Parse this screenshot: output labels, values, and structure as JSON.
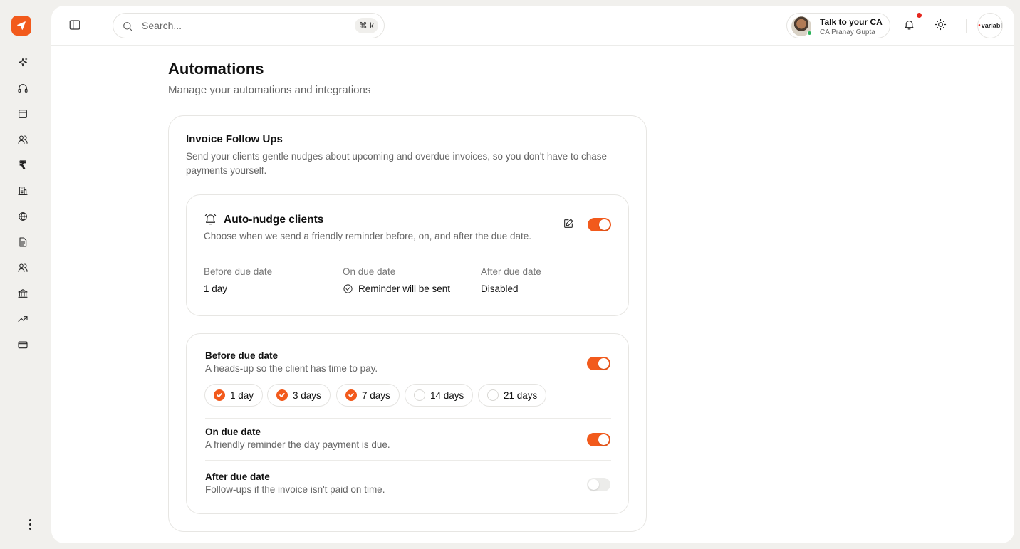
{
  "brand": {
    "accent": "#f25a1c",
    "logo_icon": "paper-plane-icon"
  },
  "rail": {
    "icons": [
      "sparkles-icon",
      "headphones-icon",
      "window-icon",
      "users-icon",
      "rupee-icon",
      "building-icon",
      "globe-icon",
      "document-icon",
      "team-icon",
      "bank-icon",
      "trending-up-icon",
      "credit-card-icon"
    ],
    "rupee_glyph": "₹"
  },
  "topbar": {
    "search_placeholder": "Search...",
    "shortcut": "⌘ k",
    "ca": {
      "title": "Talk to your CA",
      "name": "CA Pranay Gupta"
    },
    "org_logo_text": "variabl",
    "org_logo_dot": "●"
  },
  "page": {
    "title": "Automations",
    "subtitle": "Manage your automations and integrations"
  },
  "invoice_follow_ups": {
    "title": "Invoice Follow Ups",
    "description": "Send your clients gentle nudges about upcoming and overdue invoices, so you don't have to chase payments yourself.",
    "auto_nudge": {
      "title": "Auto-nudge clients",
      "description": "Choose when we send a friendly reminder before, on, and after the due date.",
      "enabled": true,
      "summary": [
        {
          "label": "Before due date",
          "value": "1 day"
        },
        {
          "label": "On due date",
          "value": "Reminder will be sent"
        },
        {
          "label": "After due date",
          "value": "Disabled"
        }
      ]
    },
    "settings": {
      "before": {
        "title": "Before due date",
        "description": "A heads-up so the client has time to pay.",
        "enabled": true,
        "options": [
          {
            "label": "1 day",
            "checked": true
          },
          {
            "label": "3 days",
            "checked": true
          },
          {
            "label": "7 days",
            "checked": true
          },
          {
            "label": "14 days",
            "checked": false
          },
          {
            "label": "21 days",
            "checked": false
          }
        ]
      },
      "on": {
        "title": "On due date",
        "description": "A friendly reminder the day payment is due.",
        "enabled": true
      },
      "after": {
        "title": "After due date",
        "description": "Follow-ups if the invoice isn't paid on time.",
        "enabled": false
      }
    }
  }
}
